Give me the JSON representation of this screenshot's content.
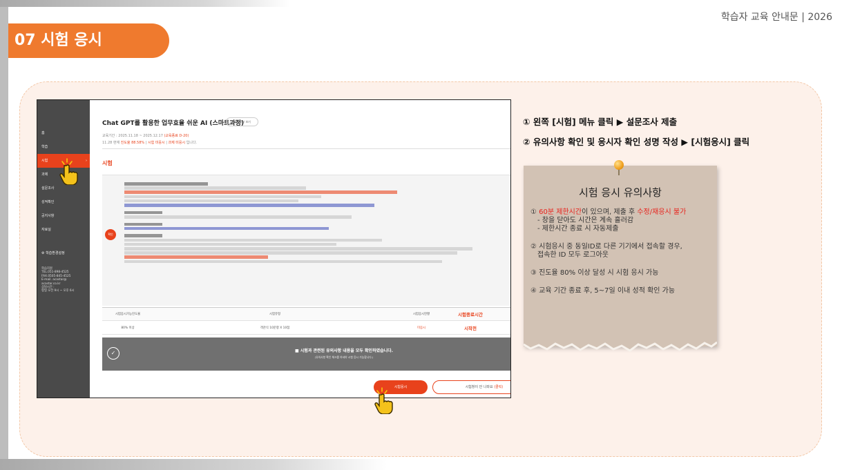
{
  "header": {
    "doc_title": "학습자 교육 안내문 | 2026"
  },
  "section": {
    "label": "07 시험 응시"
  },
  "screenshot": {
    "sidebar": {
      "items": [
        "홈",
        "학습",
        "시험",
        "과제",
        "설문조사",
        "성적확인",
        "공지사항",
        "자료실"
      ],
      "settings_label": "학습환경설정",
      "contact_lines": [
        "학습지원",
        "TEL.051-898-4525",
        "FAX.0505-845-4525",
        "E-mail. acastar@",
        "acastar.co.kr",
        "상담시간 :",
        "평일 오전 9시 ~ 오후 6시"
      ]
    },
    "course_title": "Chat GPT를 활용한 업무효율 쉬운 AI (스마트과정)",
    "course_info_button": "과정 정보 보기",
    "period_prefix": "교육기간 : 2025.11.18 ~ 2025.12.17",
    "period_status": "(교육종료 D-20)",
    "progress_prefix": "11.28 현재",
    "progress_value": "진도율 88.58%",
    "progress_exam": "시험 미응시",
    "progress_task": "과제 미응시",
    "progress_suffix": "입니다.",
    "exam_heading": "시험",
    "confirm_badge": "확인",
    "table": {
      "headers": [
        "시험응시가능진도율",
        "시험유형",
        "시험응시현황",
        "시험종료시간"
      ],
      "row": [
        "80% 이상",
        "객관식 10문항 X 10점",
        "미응시",
        "시작전"
      ]
    },
    "agree_text": "■  시험과 관련된 유의사항 내용을 모두 확인하였습니다.",
    "agree_sub": "(유의사항 확인 체크를 하셔야 시험 응시 가능합니다.)",
    "start_button": "시험응시",
    "help_button_prefix": "시험창이 안 나와요",
    "help_button_link": "(클릭)"
  },
  "instructions": {
    "step1": "① 왼쪽 [시험] 메뉴 클릭 ▶ 설문조사 제출",
    "step2": "② 유의사항 확인 및 응시자 확인 성명 작성 ▶ [시험응시] 클릭"
  },
  "note": {
    "title": "시험 응시 유의사항",
    "item1_prefix": "① ",
    "item1_red1": "60분 제한시간",
    "item1_mid": "이 있으며, 제출 후 ",
    "item1_red2": "수정/재응시 불가",
    "item1_sub1": "- 창을 닫아도 시간은 계속 흘러감",
    "item1_sub2": "- 제한시간 종료 시 자동제출",
    "item2_line1": "② 시험응시 중 동일ID로 다른 기기에서 접속할 경우,",
    "item2_line2": "접속한 ID 모두 로그아웃",
    "item3": "③ 진도율 80% 이상 달성 시 시험 응시 가능",
    "item4": "④ 교육 기간 종료 후, 5~7일 이내 성적 확인 가능"
  },
  "colors": {
    "accent": "#ef7a2e",
    "brand_red": "#e8421c",
    "panel": "#fdf1ea",
    "note_paper": "#d2c2b4"
  }
}
